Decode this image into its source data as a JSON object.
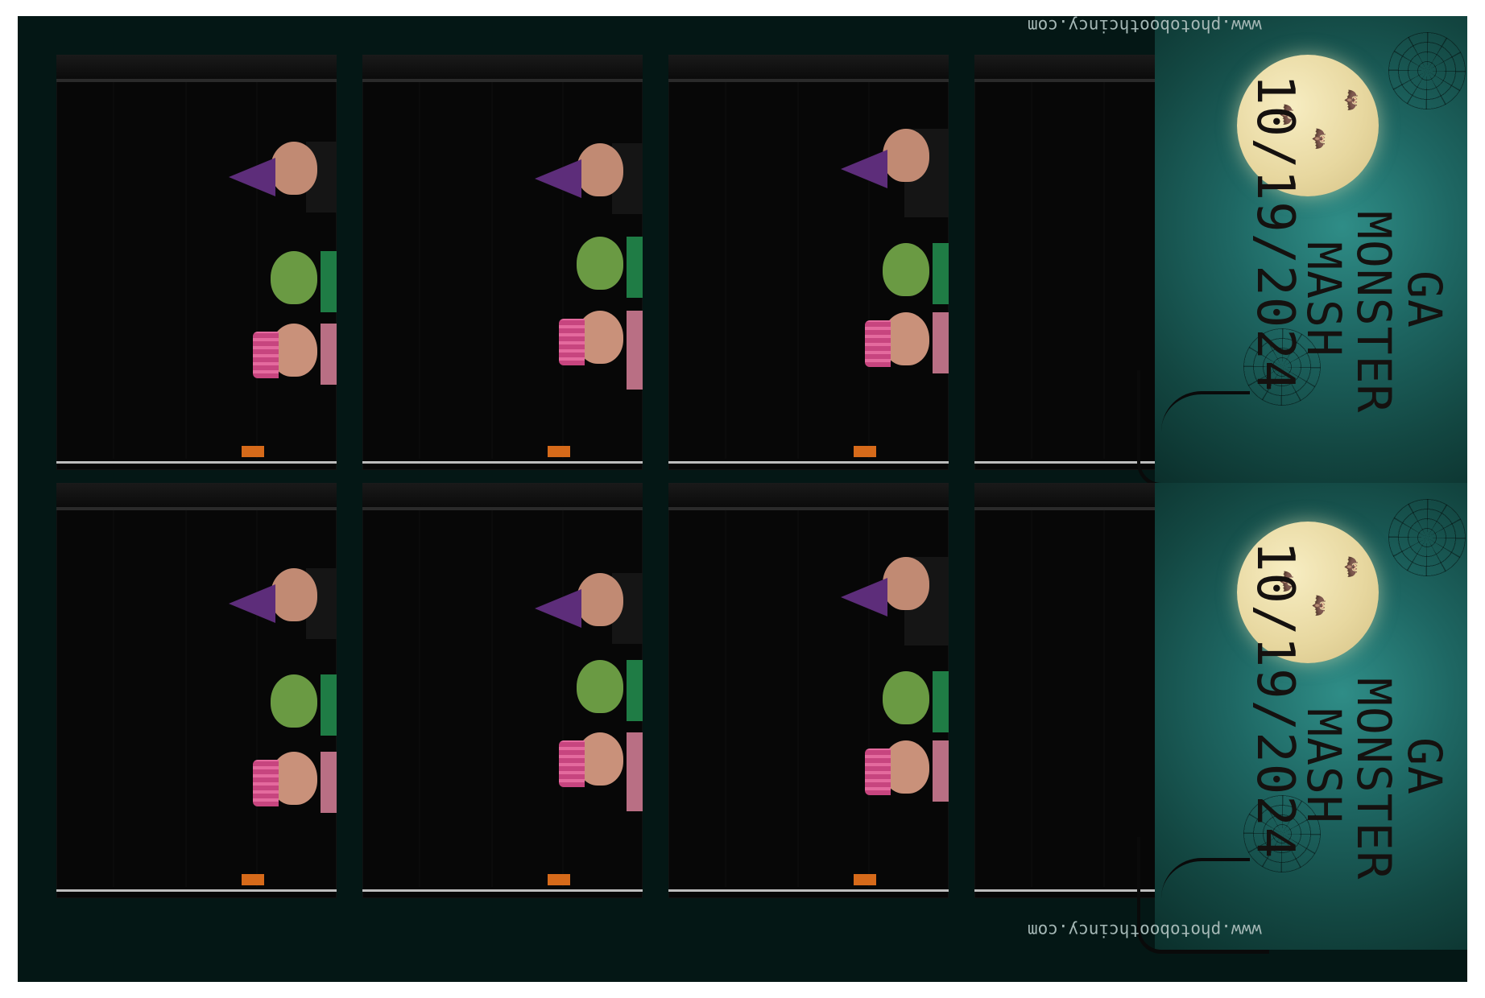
{
  "event": {
    "title_lines": [
      "GA",
      "MONSTER",
      "MASH"
    ],
    "date": "10/19/2024"
  },
  "branding": {
    "website": "www.photoboothcincy.com"
  },
  "palette": {
    "background": "#041715",
    "panel_teal": "#1e6763",
    "moon": "#e7d79f",
    "purple_hat": "#5d2d7a",
    "pink_crown": "#c7457f",
    "green_face": "#6a9a43"
  },
  "icons": {
    "moon": "moon-icon",
    "bat": "bat-icon",
    "spider_web": "spider-web-icon",
    "tree": "tree-branch-icon"
  }
}
